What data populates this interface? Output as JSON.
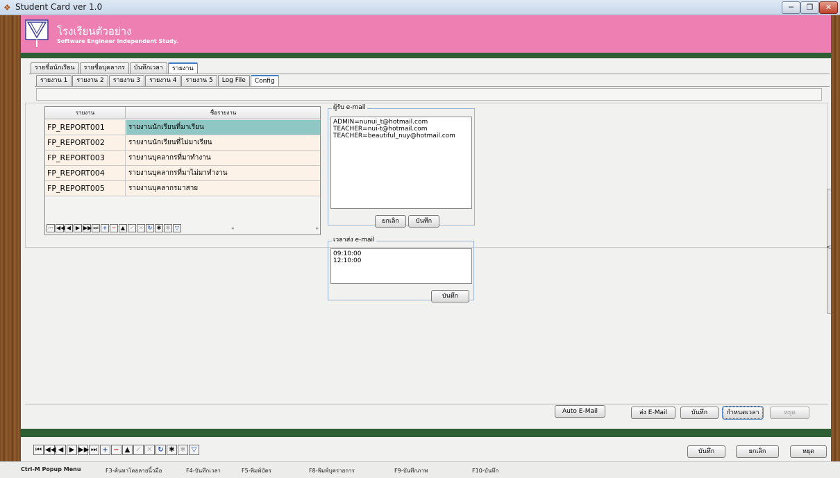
{
  "window": {
    "title": "Student Card ver 1.0",
    "minimize_label": "─",
    "maximize_label": "❐",
    "close_label": "✕"
  },
  "header": {
    "school_name": "โรงเรียนตัวอย่าง",
    "subtitle": "Software Engineer Independent Study."
  },
  "main_tabs": [
    "รายชื่อนักเรียน",
    "รายชื่อบุคลากร",
    "บันทึกเวลา",
    "รายงาน"
  ],
  "sub_tabs": [
    "รายงาน 1",
    "รายงาน 2",
    "รายงาน 3",
    "รายงาน 4",
    "รายงาน 5",
    "Log File",
    "Config"
  ],
  "report_grid": {
    "headers": [
      "รายงาน",
      "ชื่อรายงาน"
    ],
    "rows": [
      {
        "code": "FP_REPORT001",
        "name": "รายงานนักเรียนที่มาเรียน"
      },
      {
        "code": "FP_REPORT002",
        "name": "รายงานนักเรียนที่ไม่มาเรียน"
      },
      {
        "code": "FP_REPORT003",
        "name": "รายงานบุคลากรที่มาทำงาน"
      },
      {
        "code": "FP_REPORT004",
        "name": "รายงานบุคลากรที่มาไม่มาทำงาน"
      },
      {
        "code": "FP_REPORT005",
        "name": "รายงานบุคลากรมาสาย"
      }
    ],
    "scroll_left_glyph": "◂",
    "scroll_right_glyph": "▸"
  },
  "navigator_glyphs": [
    "⏮",
    "◀◀",
    "◀",
    "▶",
    "▶▶",
    "⏭",
    "+",
    "−",
    "▲",
    "✓",
    "✕",
    "↻",
    "✱",
    "✱",
    "▽"
  ],
  "email_recipients": {
    "legend": "ผู้รับ e-mail",
    "entries": [
      "ADMIN=nunui_t@hotmail.com",
      "TEACHER=nui-t@hotmail.com",
      "TEACHER=beautiful_nuy@hotmail.com"
    ],
    "cancel_label": "ยกเลิก",
    "save_label": "บันทึก"
  },
  "send_times": {
    "legend": "เวลาส่ง e-mail",
    "entries": [
      "09:10:00",
      "12:10:00"
    ],
    "save_label": "บันทึก"
  },
  "right_collapse_glyph": "<",
  "action_buttons": {
    "auto_email": "Auto E-Mail",
    "send_email": "ส่ง E-Mail",
    "save": "บันทึก",
    "set_time": "กำหนดเวลา",
    "stop": "หยุด"
  },
  "bottom_buttons": {
    "save": "บันทึก",
    "cancel": "ยกเลิก",
    "stop": "หยุด"
  },
  "status_bar": [
    "Ctrl-M  Popup Menu",
    "F3-ค้นหาโดยลายนิ้วมือ",
    "F4-บันทึกเวลา",
    "F5-พิมพ์บัตร",
    "F8-พิมพ์บุครายการ",
    "F9-บันทึกภาพ",
    "F10-บันทึก"
  ]
}
